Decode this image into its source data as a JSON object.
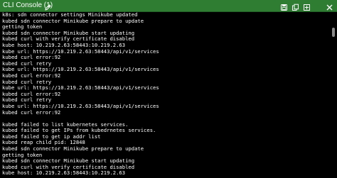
{
  "window": {
    "title": "CLI Console (1)",
    "accent_color": "#2e7d32"
  },
  "toolbar": {
    "icons": [
      "save-icon",
      "copy-icon",
      "expand-icon",
      "close-icon"
    ]
  },
  "console": {
    "lines": [
      "k8s: sdn connector settings Minikube updated",
      "kubed sdn connector Minikube prepare to update",
      "getting token",
      "kubed sdn connector Minikube start updating",
      "kubed curl with verify certificate disabled",
      "kube host: 10.219.2.63:58443:10.219.2.63",
      "kube url: https://10.219.2.63:58443/api/v1/services",
      "kubed curl error:92",
      "kubed curl retry",
      "kube url: https://10.219.2.63:58443/api/v1/services",
      "kubed curl error:92",
      "kubed curl retry",
      "kube url: https://10.219.2.63:58443/api/v1/services",
      "kubed curl error:92",
      "kubed curl retry",
      "kube url: https://10.219.2.63:58443/api/v1/services",
      "kubed curl error:92",
      "",
      "kubed failed to list kubernetes services.",
      "kubed failed to get IPs from kubedrnetes services.",
      "kubed failed to get ip addr list",
      "kubed reap child pid: 12848",
      "kubed sdn connector Minikube prepare to update",
      "getting token",
      "kubed sdn connector Minikube start updating",
      "kubed curl with verify certificate disabled",
      "kube host: 10.219.2.63:58443:10.219.2.63"
    ]
  }
}
